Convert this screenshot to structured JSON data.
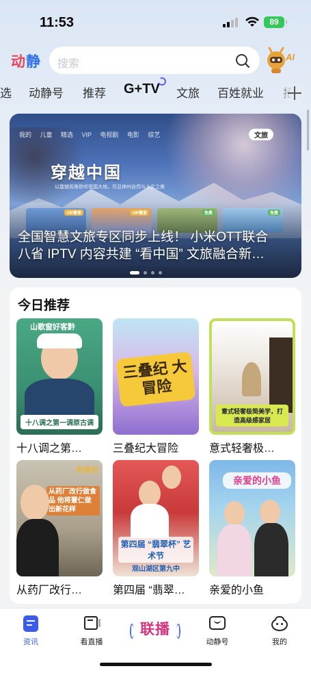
{
  "status": {
    "time": "11:53",
    "battery": "89"
  },
  "app": {
    "logo_a": "动",
    "logo_b": "静"
  },
  "search": {
    "placeholder": "搜索"
  },
  "ai": {
    "label": "AI"
  },
  "tabs": [
    "选",
    "动静号",
    "推荐",
    "G+TV",
    "文旅",
    "百姓就业",
    "招"
  ],
  "active_tab": "G+TV",
  "banner": {
    "nav": "我的 儿童 精选 VIP 电视剧 电影 综艺",
    "tag": "文旅",
    "calligraphy": "穿越中国",
    "subtitle": "以震撼视角聆听祖国大地，尽显神州自然与人文之美",
    "vip_badges": [
      "VIP尊享",
      "VIP尊享",
      "免费",
      "免费"
    ],
    "title_line1": "全国智慧文旅专区同步上线！ 小米OTT联合",
    "title_line2": "八省 IPTV 内容共建 “看中国” 文旅融合新…"
  },
  "recommend": {
    "heading": "今日推荐",
    "items": [
      {
        "caption": "十八调之第…",
        "overlay": "十八调之第一调原古调",
        "top_text": "山歌窗好客黔"
      },
      {
        "caption": "三叠纪大冒险",
        "overlay": "三叠纪 大冒险"
      },
      {
        "caption": "意式轻奢极…",
        "overlay": "意式轻奢极简美学，打造高级感家居"
      },
      {
        "caption": "从药厂改行…",
        "overlay": "从药厂改行做食品 他将薏仁做出新花样",
        "top_text": "老黄说"
      },
      {
        "caption": "第四届 “翡翠…",
        "overlay": "第四届 “翡翠杯” 艺术节",
        "bottom_text": "观山湖区第九中"
      },
      {
        "caption": "亲爱的小鱼",
        "overlay": "亲爱的小鱼"
      }
    ]
  },
  "bottom_nav": [
    {
      "label": "资讯",
      "active": true
    },
    {
      "label": "看直播",
      "active": false
    },
    {
      "label": "联播",
      "active": false
    },
    {
      "label": "动静号",
      "active": false
    },
    {
      "label": "我的",
      "active": false
    }
  ],
  "colors": {
    "accent": "#3b5ce9",
    "logo_red": "#e8465b",
    "logo_blue": "#2f6fe8",
    "lianbo": "#d8347d",
    "battery": "#35c759"
  }
}
